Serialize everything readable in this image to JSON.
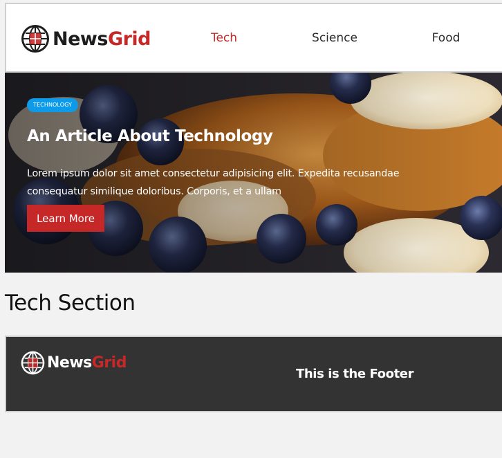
{
  "header": {
    "logo": {
      "word1": "News",
      "word2": "Grid"
    },
    "nav": [
      {
        "label": "Tech",
        "active": true
      },
      {
        "label": "Science",
        "active": false
      },
      {
        "label": "Food",
        "active": false
      }
    ]
  },
  "hero": {
    "badge": "TECHNOLOGY",
    "title": "An Article About Technology",
    "text": "Lorem ipsum dolor sit amet consectetur adipisicing elit. Expedita recusandae consequatur similique doloribus. Corporis, et a ullam",
    "button": "Learn More",
    "image": "french-toast-with-bananas-and-blueberries"
  },
  "section": {
    "title": "Tech Section"
  },
  "footer": {
    "logo": {
      "word1": "News",
      "word2": "Grid"
    },
    "text": "This is the Footer"
  },
  "colors": {
    "accent": "#c62828",
    "badge": "#0d9be9",
    "footer_bg": "#333333",
    "page_bg": "#f2f2f2"
  }
}
